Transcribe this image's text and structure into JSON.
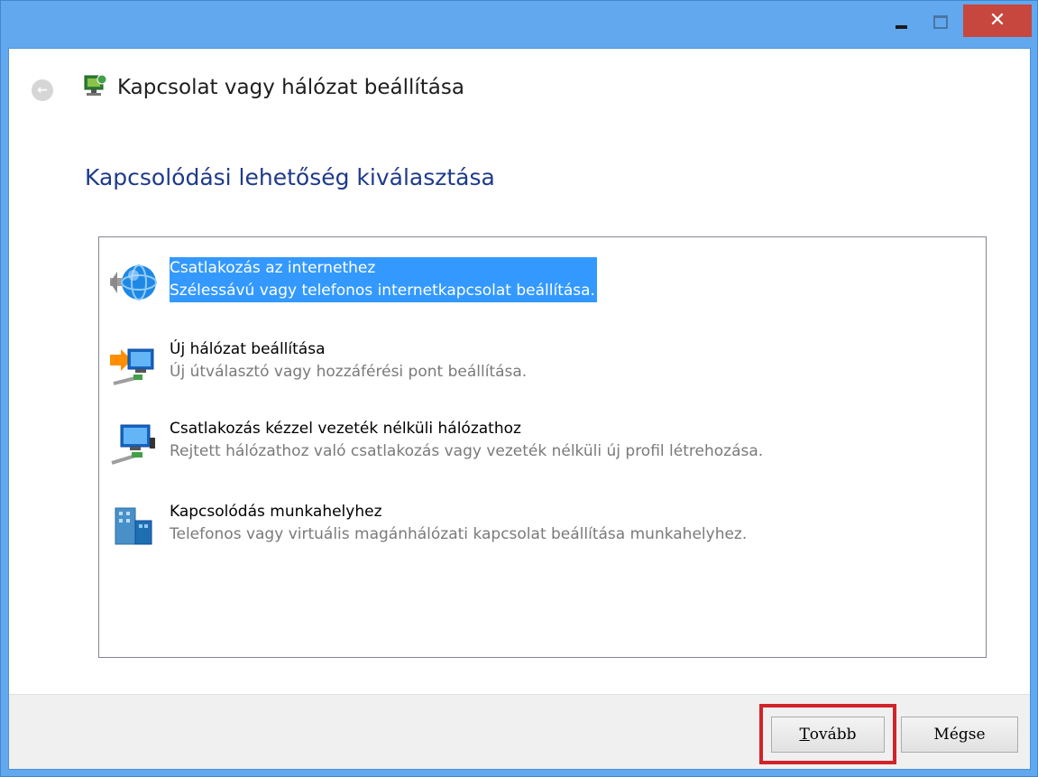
{
  "window": {
    "title": "Kapcsolat vagy hálózat beállítása",
    "close_glyph": "✕",
    "back_glyph": "←"
  },
  "page": {
    "heading": "Kapcsolódási lehetőség kiválasztása"
  },
  "options": [
    {
      "title": "Csatlakozás az internethez",
      "description": "Szélessávú vagy telefonos internetkapcsolat beállítása.",
      "icon": "globe-connect-icon",
      "selected": true
    },
    {
      "title": "Új hálózat beállítása",
      "description": "Új útválasztó vagy hozzáférési pont beállítása.",
      "icon": "new-network-icon",
      "selected": false
    },
    {
      "title": "Csatlakozás kézzel vezeték nélküli hálózathoz",
      "description": "Rejtett hálózathoz való csatlakozás vagy vezeték nélküli új profil létrehozása.",
      "icon": "wireless-network-icon",
      "selected": false
    },
    {
      "title": "Kapcsolódás munkahelyhez",
      "description": "Telefonos vagy virtuális magánhálózati kapcsolat beállítása munkahelyhez.",
      "icon": "workplace-icon",
      "selected": false
    }
  ],
  "footer": {
    "next_accel": "T",
    "next_rest": "ovább",
    "cancel_label": "Mégse"
  },
  "colors": {
    "titlebar": "#62a8ee",
    "close_button": "#c7463d",
    "selection": "#3399ff",
    "heading": "#1e3a8a",
    "highlight_frame": "#d2232a"
  }
}
